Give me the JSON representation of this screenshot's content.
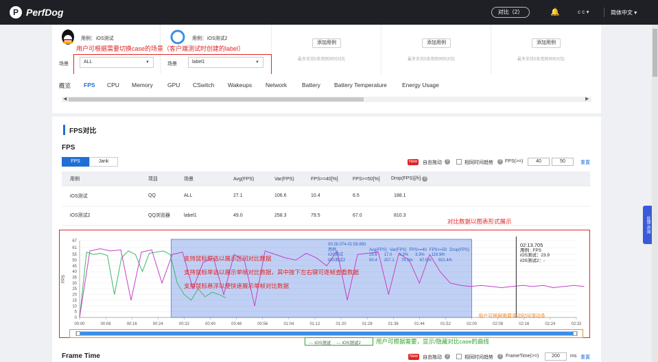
{
  "topbar": {
    "logo_letter": "P",
    "logo_text": "PerfDog",
    "compare_label": "对比（2）",
    "user": "c c ▾",
    "language": "简体中文 ▾"
  },
  "cases": [
    {
      "case_label": "用例：",
      "case_name": "iOS测试",
      "scene_label": "场景",
      "scene_value": "ALL"
    },
    {
      "case_label": "用例：",
      "case_name": "iOS测试2",
      "scene_label": "场景",
      "scene_value": "label1"
    }
  ],
  "add_case": {
    "label": "添加用例",
    "hint": "最多支持5条用例同时对比"
  },
  "tabs": [
    "概览",
    "FPS",
    "CPU",
    "Memory",
    "GPU",
    "CSwitch",
    "Wakeups",
    "Network",
    "Battery",
    "Battery Temperature",
    "Energy Usage"
  ],
  "active_tab": "FPS",
  "section_title": "FPS对比",
  "fps_block": {
    "title": "FPS",
    "segments": [
      "FPS",
      "Jank"
    ],
    "new_badge": "New",
    "free_drag": "自由拖动",
    "relative_trend": "相同时间趋势",
    "fps_threshold_label": "FPS(>=)",
    "fps_threshold_1": "40",
    "fps_threshold_2": "50",
    "reset": "重置"
  },
  "stats_table": {
    "headers": [
      "用例",
      "项目",
      "场景",
      "Avg(FPS)",
      "Var(FPS)",
      "FPS>=40[%]",
      "FPS>=50[%]",
      "Drop(FPS)[/h]"
    ],
    "rows": [
      [
        "iOS测试",
        "QQ",
        "ALL",
        "27.1",
        "106.6",
        "10.4",
        "6.5",
        "188.1"
      ],
      [
        "iOS测试2",
        "QQ浏览器",
        "label1",
        "49.0",
        "258.3",
        "79.5",
        "67.0",
        "810.3"
      ]
    ]
  },
  "annotations": {
    "case_switch": "用户可根据需要切换case的场景（客户端测试时创建的label）",
    "chart_compare": "对比数据以图表形式展示",
    "box_select": "支持鼠标框选以展示区间对比数据",
    "single_select": "支持鼠标单选以展示单帧对比数据，其中按下左右键可逐帧查看数据",
    "hover": "支持鼠标悬浮以便快速展示单帧对比数据",
    "slider": "用户可根据需要滑动时间滑动条",
    "legend_toggle": "用户可根据需要，显示/隐藏对比case的曲线"
  },
  "chart_data": {
    "type": "line",
    "ylabel": "FPS",
    "y_ticks": [
      0,
      5,
      10,
      15,
      20,
      25,
      30,
      35,
      40,
      45,
      50,
      55,
      61,
      67
    ],
    "x_ticks": [
      "00:00",
      "00:08",
      "00:16",
      "00:24",
      "00:32",
      "00:40",
      "00:48",
      "00:56",
      "01:04",
      "01:12",
      "01:20",
      "01:28",
      "01:36",
      "01:44",
      "01:52",
      "02:00",
      "02:08",
      "02:16",
      "02:24",
      "02:32"
    ],
    "series": [
      {
        "name": "iOS测试",
        "color": "#3cb86b",
        "values": [
          0,
          57,
          55,
          56,
          54,
          20,
          52,
          58,
          55,
          40,
          56,
          57,
          58,
          55,
          30,
          20,
          15,
          25,
          18,
          22,
          20,
          17
        ]
      },
      {
        "name": "iOS测试2",
        "color": "#c43fc4",
        "values": [
          0,
          58,
          60,
          58,
          59,
          15,
          57,
          59,
          30,
          55,
          57,
          25,
          48,
          52,
          20,
          55,
          50,
          10,
          58,
          55,
          52,
          50,
          56,
          52,
          45,
          58,
          15,
          55,
          56,
          57,
          20,
          56,
          50,
          30,
          55,
          40,
          30,
          28,
          27,
          28,
          27,
          26,
          27,
          28,
          27,
          28,
          26,
          27,
          28,
          27
        ]
      }
    ],
    "selection_tooltip": {
      "time": "00:28.074-01:59.850",
      "headers": [
        "用例",
        "Avg(FPS)",
        "Var(FPS)",
        "FPS>=40",
        "FPS>=50",
        "Drop(FPS)"
      ],
      "rows": [
        [
          "iOS测试",
          "25.6",
          "17.0",
          "3.3%",
          "3.3%",
          "119.9/h"
        ],
        [
          "iOS测试2",
          "50.4",
          "207.1",
          "79.5%",
          "67.5%",
          "921.4/h"
        ]
      ]
    },
    "cursor_tooltip": {
      "time": "02:13.705",
      "lines": [
        "用例     : FPS",
        "iOS测试：23.9",
        "iOS测试2：-"
      ]
    },
    "legend": [
      "iOS测试",
      "iOS测试2"
    ]
  },
  "frame_time": {
    "title": "Frame Time",
    "new_badge": "New",
    "free_drag": "自由拖动",
    "relative_trend": "相同时间趋势",
    "threshold_label": "FrameTime(>=)",
    "threshold_value": "200",
    "unit": "ms",
    "reset": "重置"
  },
  "side_float": "反馈·咨询"
}
